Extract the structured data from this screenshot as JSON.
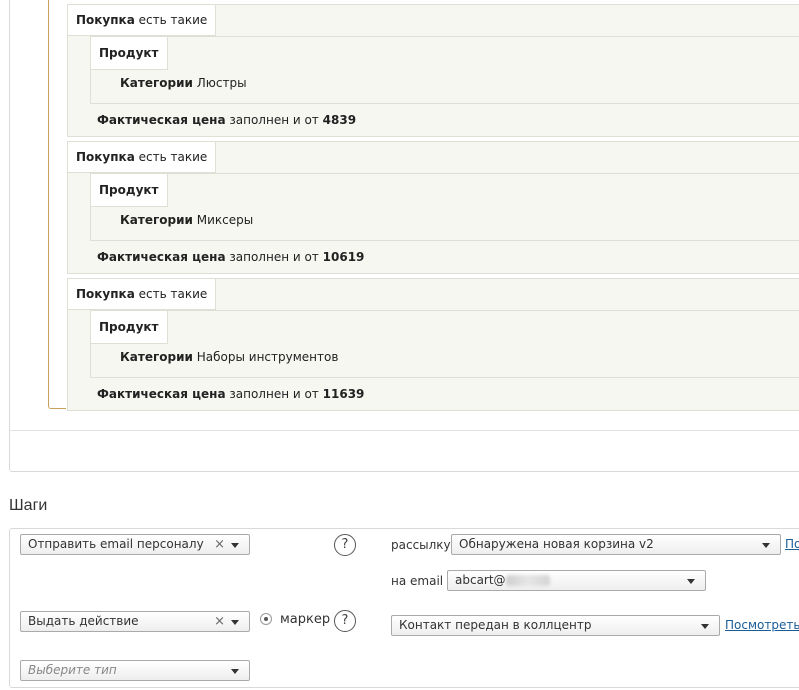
{
  "conditions": {
    "purchases": [
      {
        "tab_label": "Покупка",
        "tab_value": "есть такие",
        "product_tab": "Продукт",
        "category_label": "Категории",
        "category_value": "Люстры",
        "price_label": "Фактическая цена",
        "price_condition": "заполнен и от",
        "price_value": "4839"
      },
      {
        "tab_label": "Покупка",
        "tab_value": "есть такие",
        "product_tab": "Продукт",
        "category_label": "Категории",
        "category_value": "Миксеры",
        "price_label": "Фактическая цена",
        "price_condition": "заполнен и от",
        "price_value": "10619"
      },
      {
        "tab_label": "Покупка",
        "tab_value": "есть такие",
        "product_tab": "Продукт",
        "category_label": "Категории",
        "category_value": "Наборы инструментов",
        "price_label": "Фактическая цена",
        "price_condition": "заполнен и от",
        "price_value": "11639"
      }
    ]
  },
  "steps": {
    "title": "Шаги",
    "step1": {
      "type_value": "Отправить email персоналу",
      "mailing_label": "рассылку",
      "mailing_value": "Обнаружена новая корзина v2",
      "mailing_link": "По",
      "email_label": "на email",
      "email_value": "abcart@"
    },
    "step2": {
      "type_value": "Выдать действие",
      "marker_label": "маркер",
      "action_value": "Контакт передан в коллцентр",
      "action_link": "Посмотреть"
    },
    "step3": {
      "type_placeholder": "Выберите тип"
    },
    "help_glyph": "?",
    "clear_glyph": "×"
  }
}
